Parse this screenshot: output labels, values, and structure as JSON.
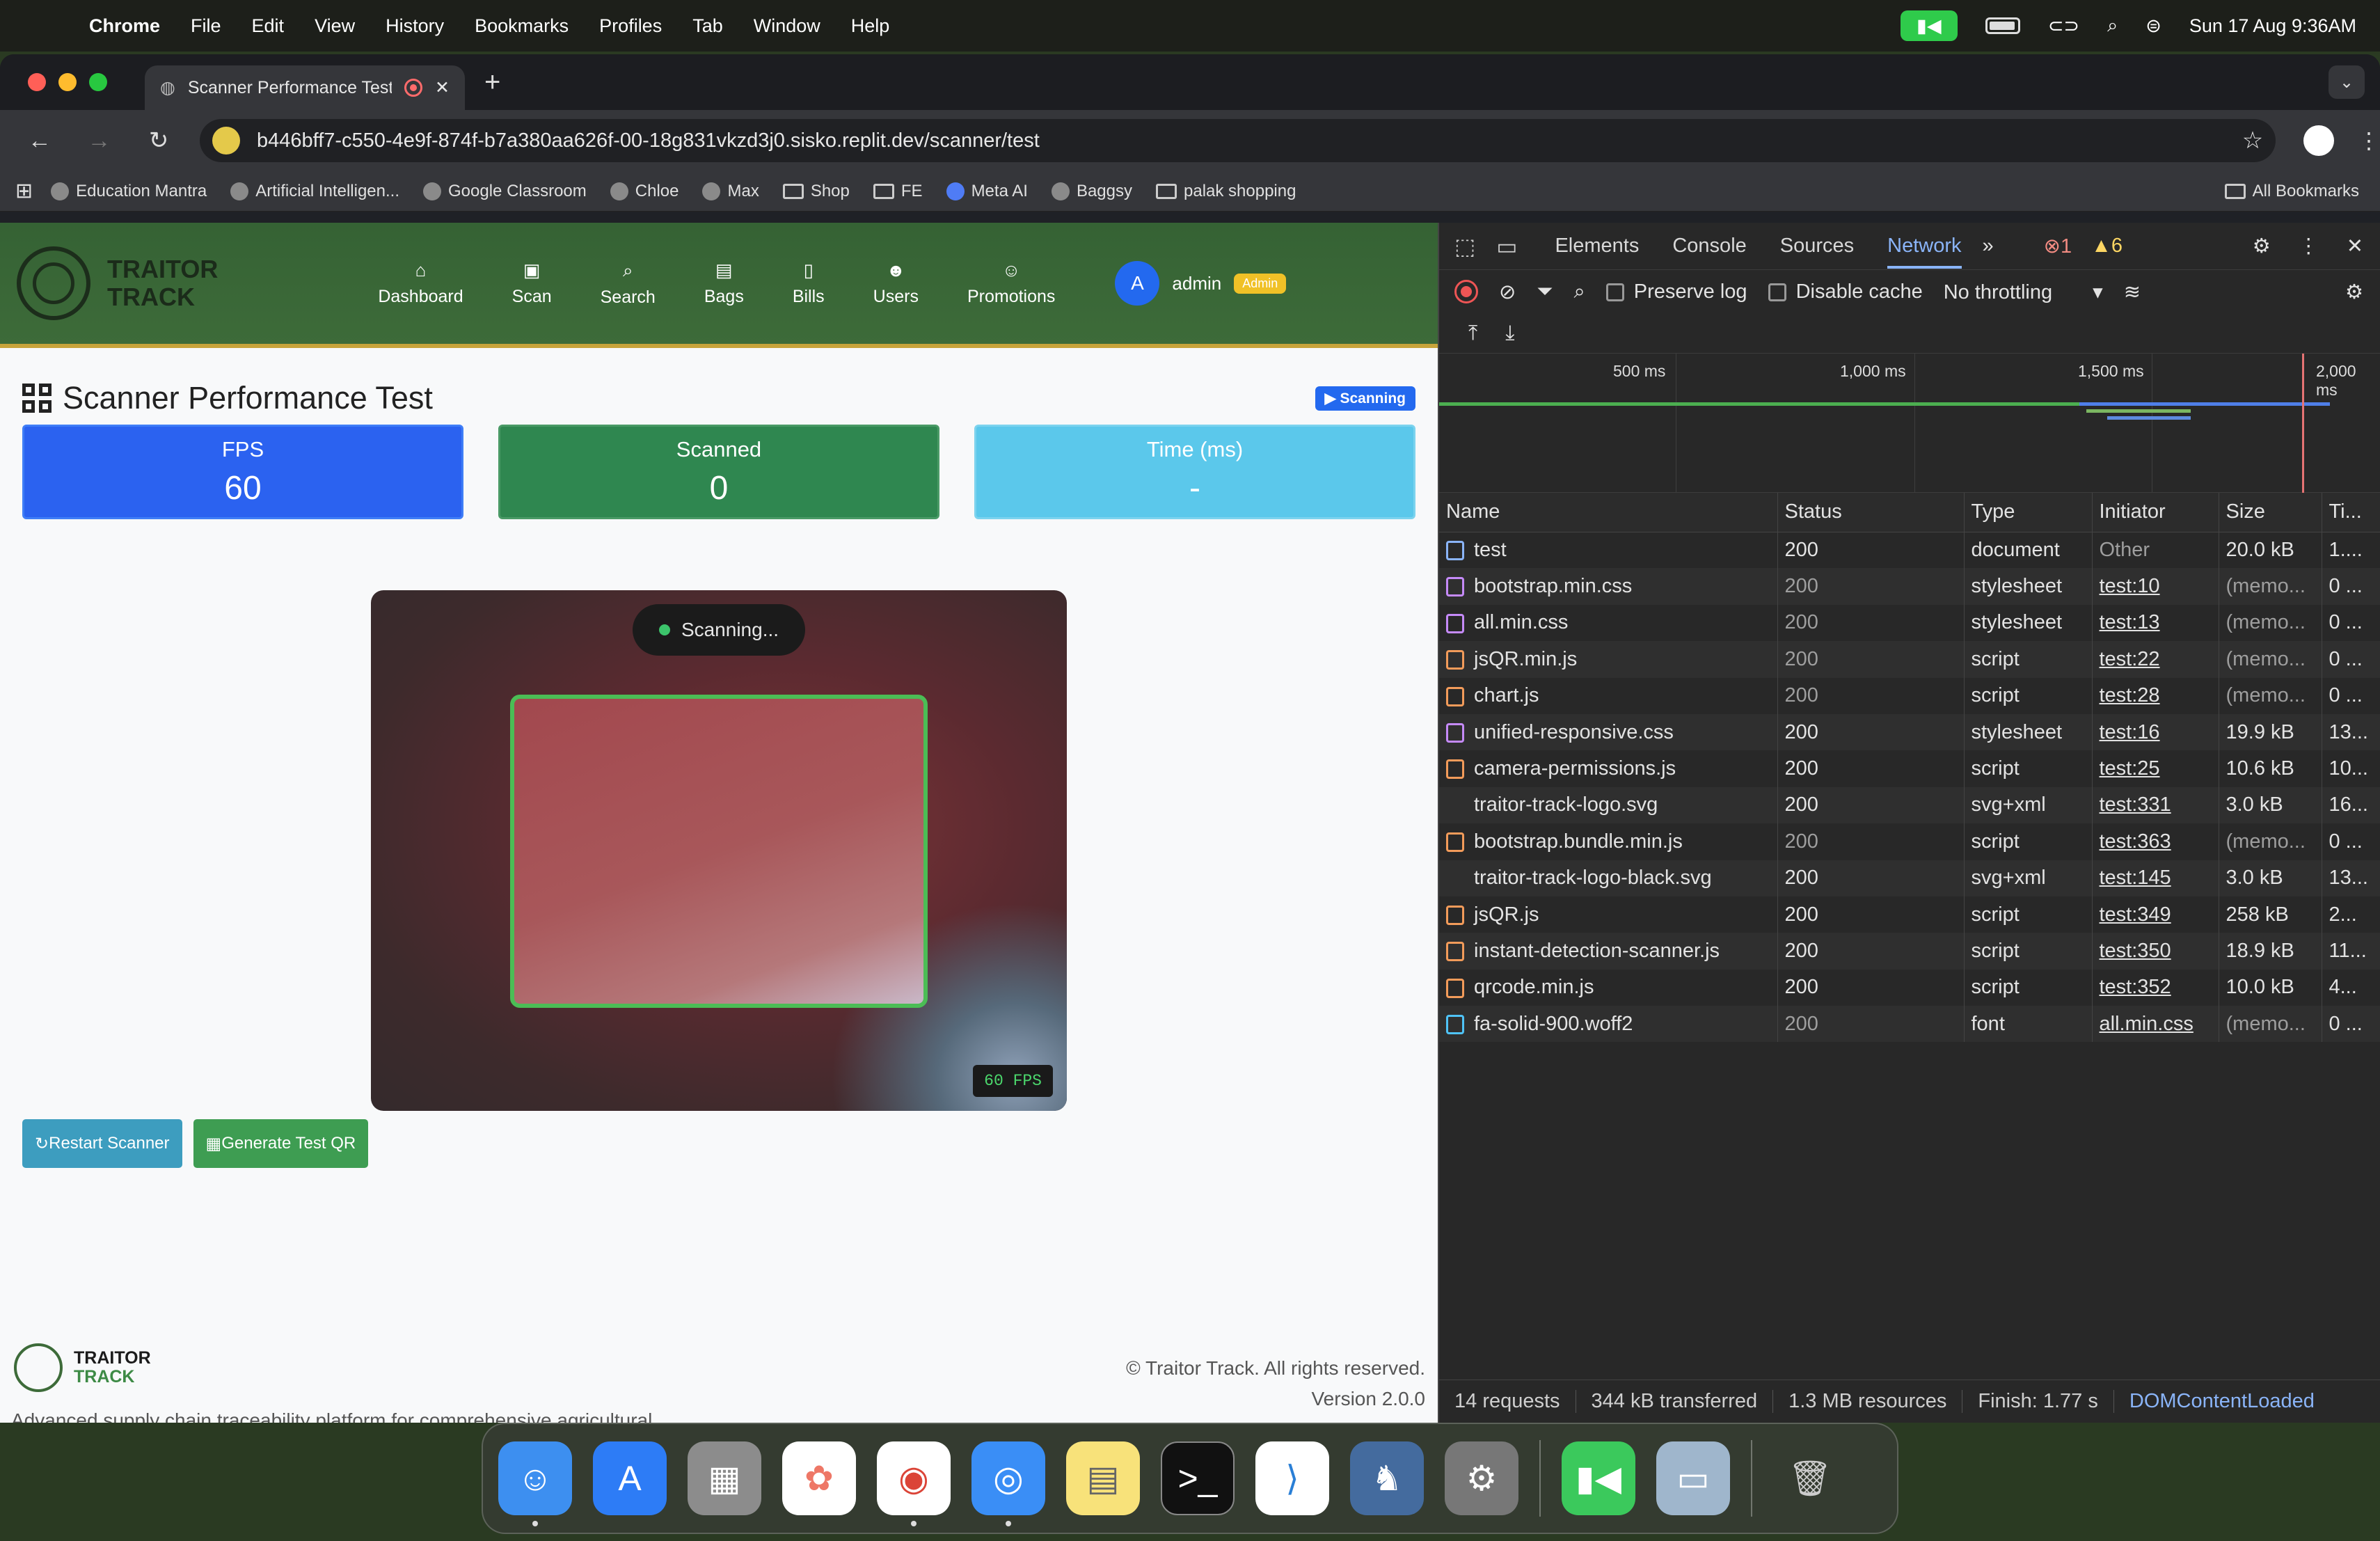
{
  "menubar": {
    "app": "Chrome",
    "items": [
      "File",
      "Edit",
      "View",
      "History",
      "Bookmarks",
      "Profiles",
      "Tab",
      "Window",
      "Help"
    ],
    "clock": "Sun 17 Aug  9:36AM"
  },
  "browser": {
    "tab_title": "Scanner Performance Test",
    "url": "b446bff7-c550-4e9f-874f-b7a380aa626f-00-18g831vkzd3j0.sisko.replit.dev/scanner/test",
    "bookmarks": [
      "Education Mantra",
      "Artificial Intelligen...",
      "Google Classroom",
      "Chloe",
      "Max",
      "Shop",
      "FE",
      "Meta AI",
      "Baggsy",
      "palak shopping"
    ],
    "all_bookmarks": "All Bookmarks"
  },
  "app": {
    "logo_line1": "TRAITOR",
    "logo_line2": "TRACK",
    "nav": [
      "Dashboard",
      "Scan",
      "Search",
      "Bags",
      "Bills",
      "Users",
      "Promotions"
    ],
    "user_initial": "A",
    "user_name": "admin",
    "user_role": "Admin"
  },
  "page": {
    "title": "Scanner Performance Test",
    "status_badge": "Scanning",
    "stats": {
      "fps_label": "FPS",
      "fps_value": "60",
      "scanned_label": "Scanned",
      "scanned_value": "0",
      "time_label": "Time (ms)",
      "time_value": "-"
    },
    "camera_status": "Scanning...",
    "camera_fps": "60 FPS",
    "restart_button": "Restart Scanner",
    "generate_button": "Generate Test QR"
  },
  "footer": {
    "brand1": "TRAITOR",
    "brand2": "TRACK",
    "description": "Advanced supply chain traceability platform for comprehensive agricultural product tracking.",
    "copyright": "© Traitor Track. All rights reserved.",
    "version": "Version 2.0.0"
  },
  "devtools": {
    "tabs": [
      "Elements",
      "Console",
      "Sources",
      "Network"
    ],
    "active_tab": "Network",
    "errors": "1",
    "warnings": "6",
    "preserve_log": "Preserve log",
    "disable_cache": "Disable cache",
    "throttling": "No throttling",
    "timeline_labels": [
      "500 ms",
      "1,000 ms",
      "1,500 ms",
      "2,000 ms"
    ],
    "columns": [
      "Name",
      "Status",
      "Type",
      "Initiator",
      "Size",
      "Ti..."
    ],
    "rows": [
      {
        "name": "test",
        "status": "200",
        "type": "document",
        "initiator": "Other",
        "size": "20.0 kB",
        "time": "1....",
        "kind": "doc"
      },
      {
        "name": "bootstrap.min.css",
        "status": "200",
        "type": "stylesheet",
        "initiator": "test:10",
        "size": "(memo...",
        "time": "0 ...",
        "kind": "css"
      },
      {
        "name": "all.min.css",
        "status": "200",
        "type": "stylesheet",
        "initiator": "test:13",
        "size": "(memo...",
        "time": "0 ...",
        "kind": "css"
      },
      {
        "name": "jsQR.min.js",
        "status": "200",
        "type": "script",
        "initiator": "test:22",
        "size": "(memo...",
        "time": "0 ...",
        "kind": "js"
      },
      {
        "name": "chart.js",
        "status": "200",
        "type": "script",
        "initiator": "test:28",
        "size": "(memo...",
        "time": "0 ...",
        "kind": "js"
      },
      {
        "name": "unified-responsive.css",
        "status": "200",
        "type": "stylesheet",
        "initiator": "test:16",
        "size": "19.9 kB",
        "time": "13...",
        "kind": "css"
      },
      {
        "name": "camera-permissions.js",
        "status": "200",
        "type": "script",
        "initiator": "test:25",
        "size": "10.6 kB",
        "time": "10...",
        "kind": "js"
      },
      {
        "name": "traitor-track-logo.svg",
        "status": "200",
        "type": "svg+xml",
        "initiator": "test:331",
        "size": "3.0 kB",
        "time": "16...",
        "kind": "none"
      },
      {
        "name": "bootstrap.bundle.min.js",
        "status": "200",
        "type": "script",
        "initiator": "test:363",
        "size": "(memo...",
        "time": "0 ...",
        "kind": "js"
      },
      {
        "name": "traitor-track-logo-black.svg",
        "status": "200",
        "type": "svg+xml",
        "initiator": "test:145",
        "size": "3.0 kB",
        "time": "13...",
        "kind": "none"
      },
      {
        "name": "jsQR.js",
        "status": "200",
        "type": "script",
        "initiator": "test:349",
        "size": "258 kB",
        "time": "2...",
        "kind": "js"
      },
      {
        "name": "instant-detection-scanner.js",
        "status": "200",
        "type": "script",
        "initiator": "test:350",
        "size": "18.9 kB",
        "time": "11...",
        "kind": "js"
      },
      {
        "name": "qrcode.min.js",
        "status": "200",
        "type": "script",
        "initiator": "test:352",
        "size": "10.0 kB",
        "time": "4...",
        "kind": "js"
      },
      {
        "name": "fa-solid-900.woff2",
        "status": "200",
        "type": "font",
        "initiator": "all.min.css",
        "size": "(memo...",
        "time": "0 ...",
        "kind": "font"
      }
    ],
    "summary": {
      "requests": "14 requests",
      "transferred": "344 kB transferred",
      "resources": "1.3 MB resources",
      "finish": "Finish: 1.77 s",
      "dcl": "DOMContentLoaded"
    }
  },
  "colors": {
    "nav_green": "#3d6b39",
    "fps_blue": "#2b62f0",
    "scanned_green": "#2f8750",
    "time_cyan": "#5bc8eb",
    "devtools_accent": "#8ab4f8"
  }
}
